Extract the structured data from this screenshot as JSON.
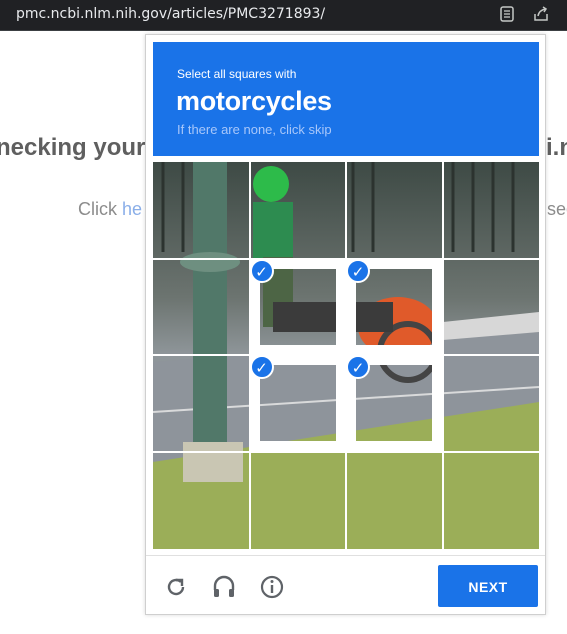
{
  "browser": {
    "url": "pmc.ncbi.nlm.nih.gov/articles/PMC3271893/",
    "reader_icon": "reader-mode-icon",
    "share_icon": "share-icon"
  },
  "background_page": {
    "heading_left": "necking your",
    "heading_right": "i.n",
    "click_text": "Click ",
    "click_link": "he",
    "click_trailing": "sec"
  },
  "captcha": {
    "instruction": "Select all squares with",
    "target": "motorcycles",
    "skip_hint": "If there are none, click skip",
    "tiles": [
      {
        "row": 0,
        "col": 0,
        "selected": false
      },
      {
        "row": 0,
        "col": 1,
        "selected": false
      },
      {
        "row": 0,
        "col": 2,
        "selected": false
      },
      {
        "row": 0,
        "col": 3,
        "selected": false
      },
      {
        "row": 1,
        "col": 0,
        "selected": false
      },
      {
        "row": 1,
        "col": 1,
        "selected": true
      },
      {
        "row": 1,
        "col": 2,
        "selected": true
      },
      {
        "row": 1,
        "col": 3,
        "selected": false
      },
      {
        "row": 2,
        "col": 0,
        "selected": false
      },
      {
        "row": 2,
        "col": 1,
        "selected": true
      },
      {
        "row": 2,
        "col": 2,
        "selected": true
      },
      {
        "row": 2,
        "col": 3,
        "selected": false
      },
      {
        "row": 3,
        "col": 0,
        "selected": false
      },
      {
        "row": 3,
        "col": 1,
        "selected": false
      },
      {
        "row": 3,
        "col": 2,
        "selected": false
      },
      {
        "row": 3,
        "col": 3,
        "selected": false
      }
    ],
    "controls": {
      "reload_icon": "reload-icon",
      "audio_icon": "headphones-icon",
      "info_icon": "info-icon",
      "next_label": "NEXT"
    },
    "colors": {
      "accent": "#1a73e8"
    }
  }
}
